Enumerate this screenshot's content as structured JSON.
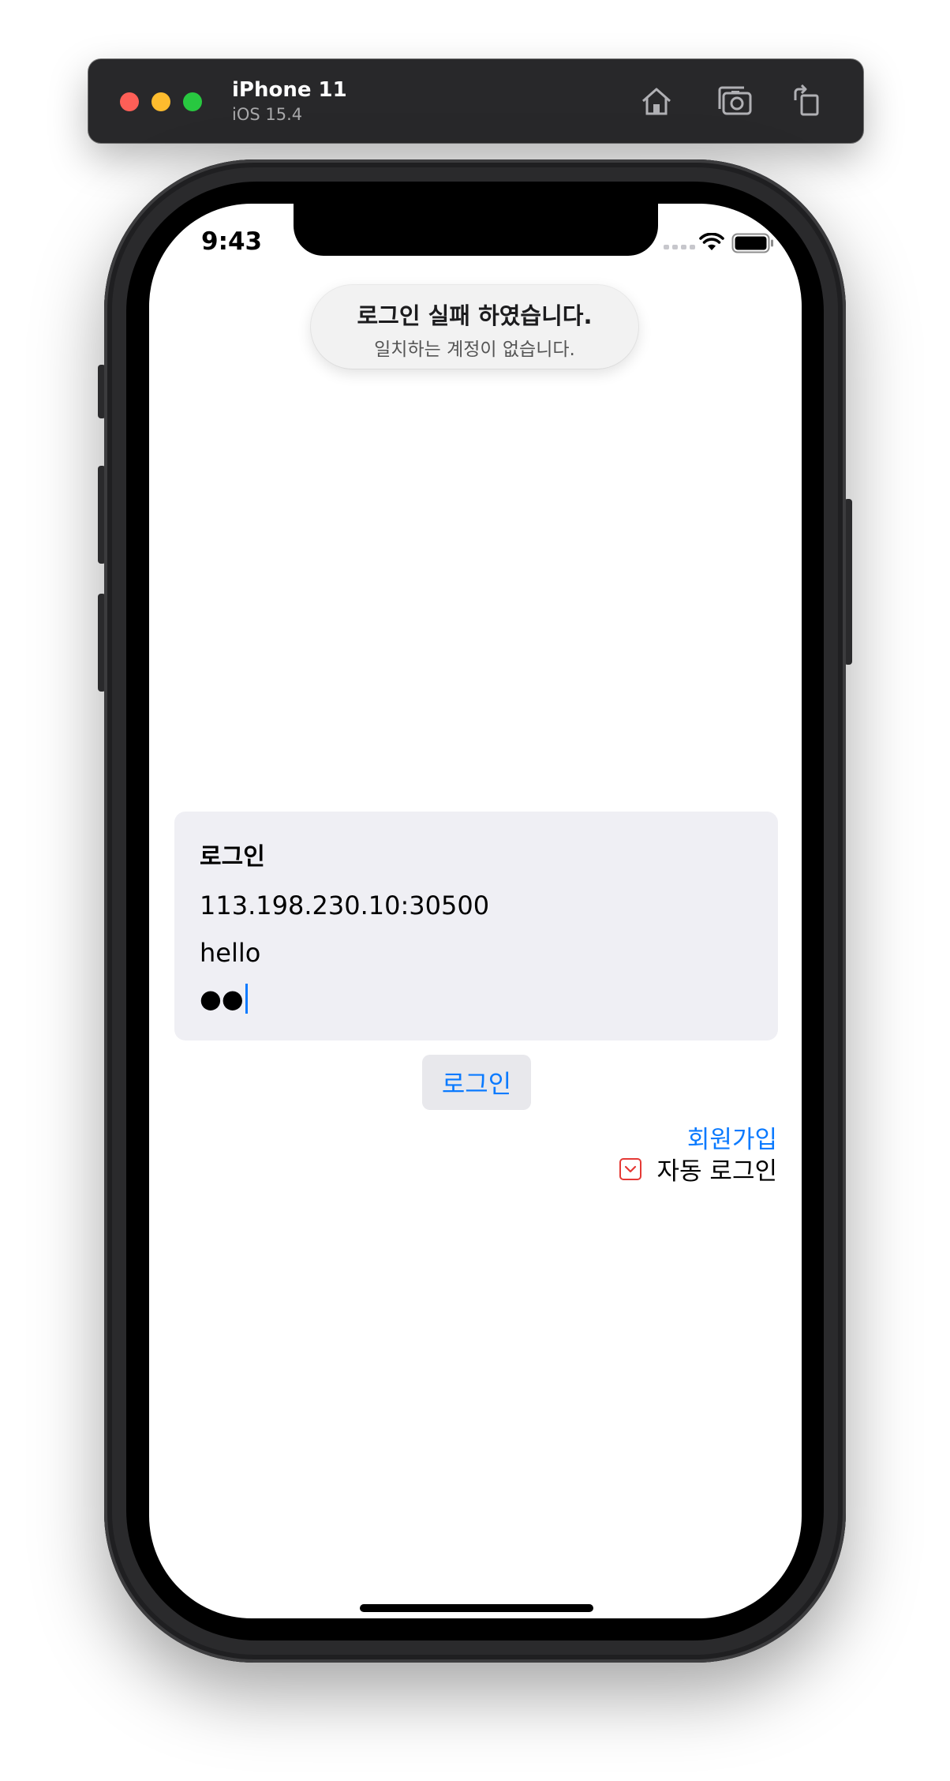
{
  "simulator": {
    "device_name": "iPhone 11",
    "os_version": "iOS 15.4",
    "toolbar_icons": [
      "home-icon",
      "screenshot-icon",
      "rotate-icon"
    ]
  },
  "status_bar": {
    "time": "9:43",
    "icons": [
      "cellular-icon",
      "wifi-icon",
      "battery-icon"
    ]
  },
  "toast": {
    "title": "로그인 실패 하였습니다.",
    "message": "일치하는 계정이 없습니다."
  },
  "login_form": {
    "title": "로그인",
    "server": "113.198.230.10:30500",
    "username": "hello",
    "password_masked": "●●"
  },
  "actions": {
    "login_button": "로그인",
    "signup_link": "회원가입",
    "auto_login_label": "자동 로그인",
    "auto_login_icon": "chevron-down-icon"
  },
  "colors": {
    "accent": "#0a7aff",
    "checkbox": "#e53935"
  }
}
